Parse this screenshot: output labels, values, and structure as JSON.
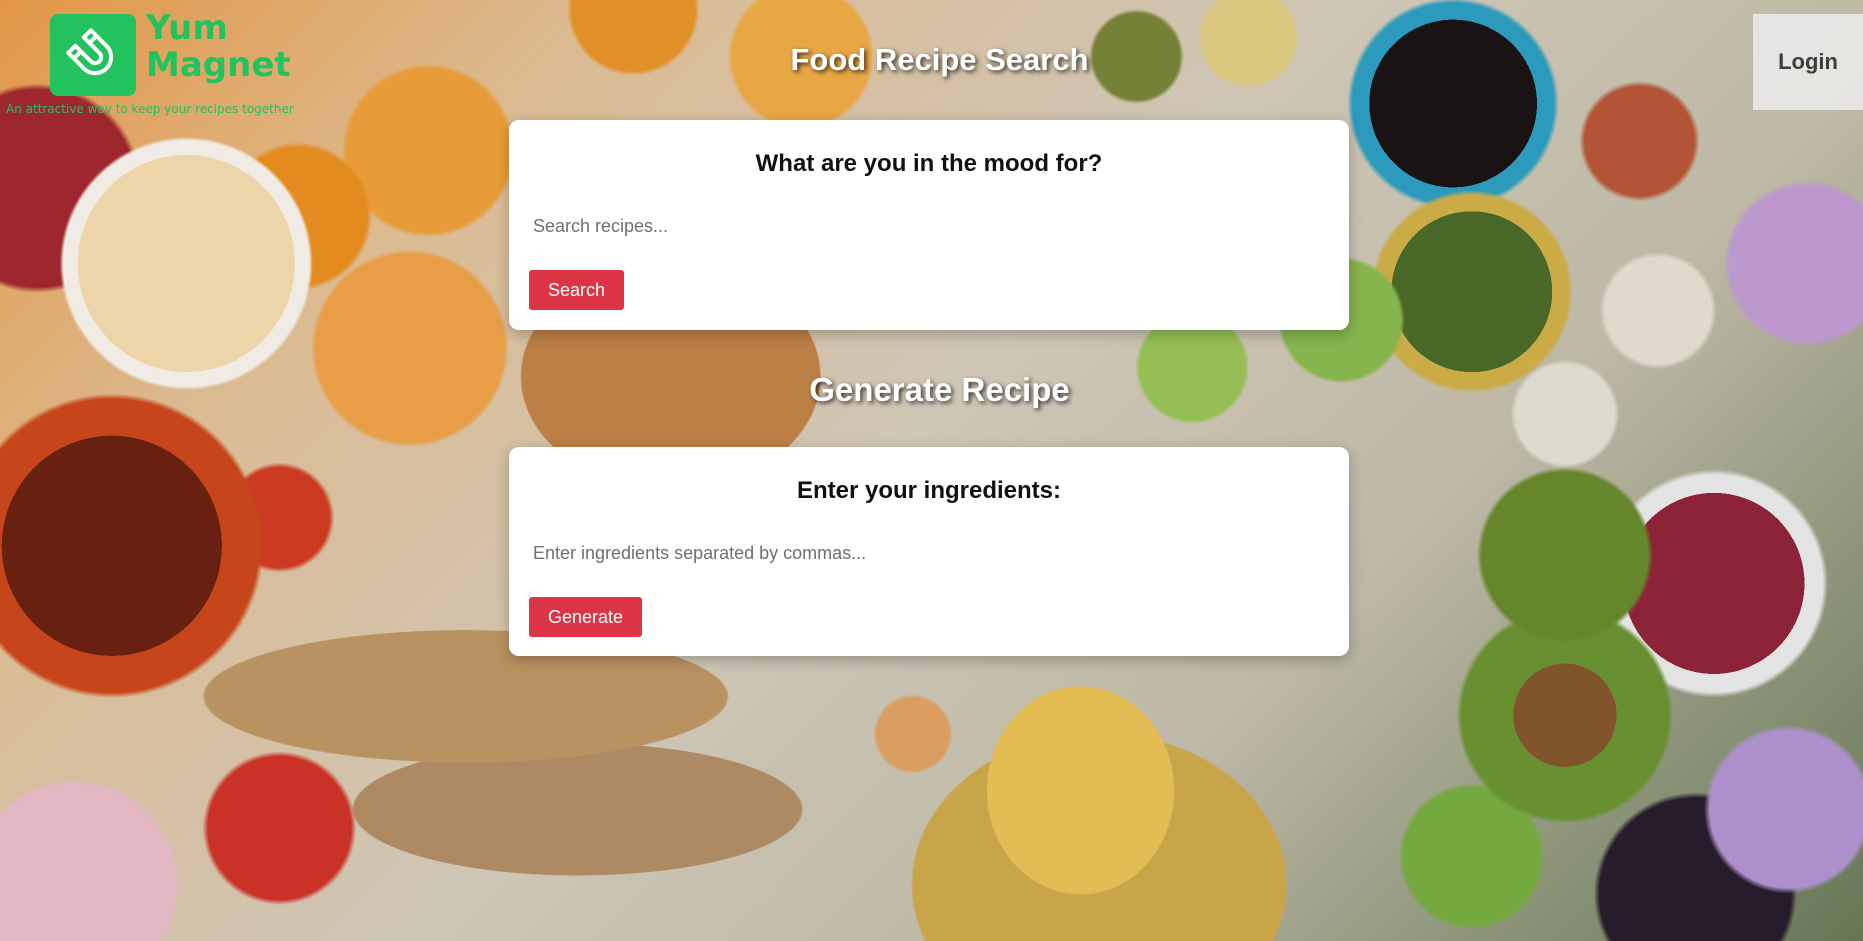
{
  "brand": {
    "name": "Yum Magnet",
    "tagline": "An attractive way to keep your recipes together",
    "logo_icon": "magnet-icon",
    "color": "#22c35e"
  },
  "header": {
    "login_label": "Login"
  },
  "search_section": {
    "title": "Food Recipe Search",
    "heading": "What are you in the mood for?",
    "placeholder": "Search recipes...",
    "value": "",
    "button_label": "Search"
  },
  "generate_section": {
    "title": "Generate Recipe",
    "heading": "Enter your ingredients:",
    "placeholder": "Enter ingredients separated by commas...",
    "value": "",
    "button_label": "Generate"
  },
  "colors": {
    "accent": "#dc3545",
    "card": "#ffffff",
    "title_text": "#ffffff"
  }
}
